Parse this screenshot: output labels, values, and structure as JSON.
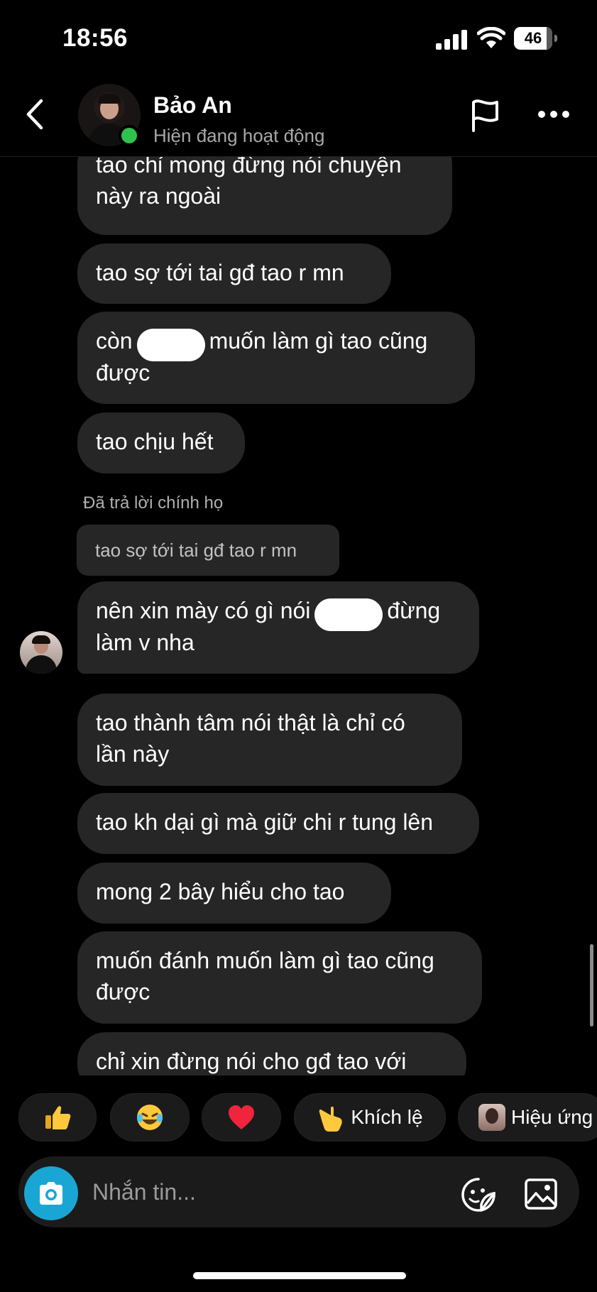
{
  "status_bar": {
    "time": "18:56",
    "battery": "46",
    "battery_fraction": 0.85
  },
  "header": {
    "contact_name": "Bảo An",
    "contact_status": "Hiện đang hoạt động"
  },
  "messages": [
    {
      "lines": [
        "tao chỉ mong đừng nói chuyện",
        "này ra ngoài"
      ]
    },
    {
      "lines": [
        "tao sợ tới tai gđ tao r mn"
      ]
    },
    {
      "before": "còn",
      "after": "muốn làm gì tao cũng",
      "line2": "được"
    },
    {
      "lines": [
        "tao chịu hết"
      ]
    },
    {
      "reply_label": "Đã trả lời chính họ",
      "reply_quote": "tao sợ tới tai gđ tao r mn"
    },
    {
      "before": "nên xin mày có gì nói",
      "after": "đừng",
      "line2": "làm v nha"
    },
    {
      "lines": [
        "tao thành tâm nói thật là chỉ có",
        "lần này"
      ]
    },
    {
      "lines": [
        "tao kh dại gì mà giữ chi r tung lên"
      ]
    },
    {
      "lines": [
        "mong 2 bây hiểu cho tao"
      ]
    },
    {
      "lines": [
        "muốn đánh muốn làm gì tao cũng",
        "được"
      ]
    },
    {
      "lines": [
        "chỉ xin đừng nói cho gđ tao với"
      ]
    }
  ],
  "reactions": [
    {
      "icon": "thumbs-up-icon"
    },
    {
      "icon": "laughing-emoji-icon"
    },
    {
      "icon": "red-heart-icon"
    },
    {
      "icon": "pointing-hand-icon",
      "label": "Khích lệ"
    },
    {
      "icon": "effect-thumbnail",
      "label": "Hiệu ứng"
    }
  ],
  "composer": {
    "placeholder": "Nhắn tin..."
  },
  "colors": {
    "bubble": "#262626",
    "background": "#000000",
    "online": "#31c24d",
    "camera": "#1aa6d4"
  }
}
